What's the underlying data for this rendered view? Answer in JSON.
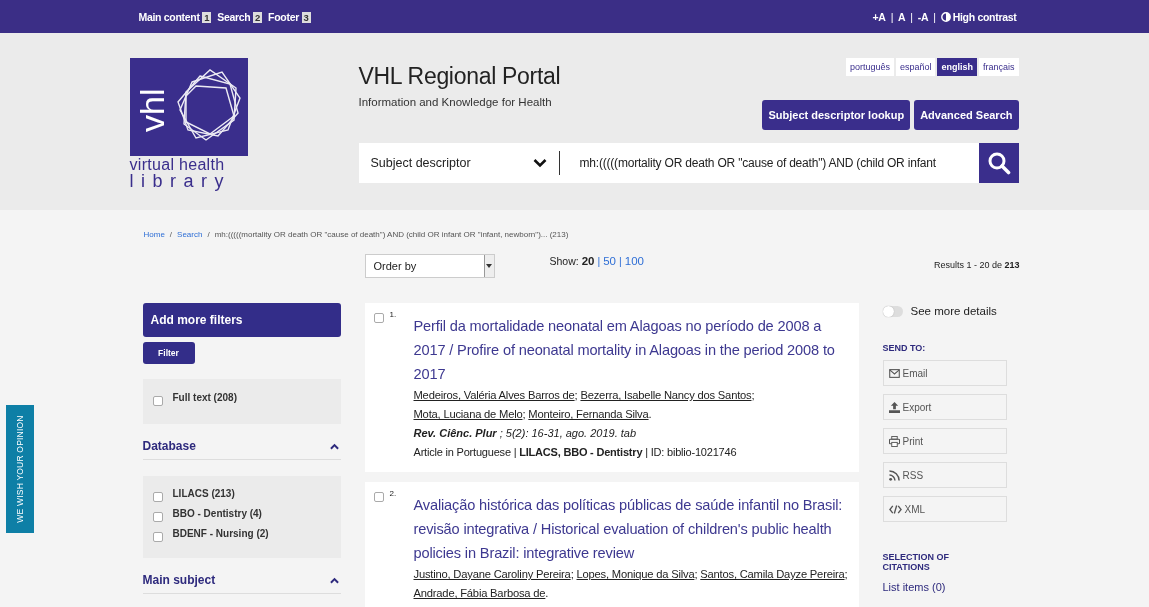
{
  "topbar": {
    "skip_links": [
      {
        "label": "Main content",
        "key": "1"
      },
      {
        "label": "Search",
        "key": "2"
      },
      {
        "label": "Footer",
        "key": "3"
      }
    ],
    "font_controls": [
      "+A",
      "A",
      "-A"
    ],
    "separator": "|",
    "contrast": "High contrast"
  },
  "logo": {
    "mark": "vhl",
    "line1": "virtual health",
    "line2": "library"
  },
  "header": {
    "title": "VHL Regional Portal",
    "subtitle": "Information and Knowledge for Health",
    "languages": [
      {
        "label": "português",
        "selected": false
      },
      {
        "label": "español",
        "selected": false
      },
      {
        "label": "english",
        "selected": true
      },
      {
        "label": "français",
        "selected": false
      }
    ],
    "buttons": [
      "Subject descriptor lookup",
      "Advanced Search"
    ],
    "search": {
      "scope": "Subject descriptor",
      "value": "mh:(((((mortality OR death OR \"cause of death\") AND (child OR infant"
    }
  },
  "breadcrumb": {
    "links": [
      "Home",
      "Search"
    ],
    "separator": "/",
    "current": "mh:(((((mortality OR death OR \"cause of death\") AND (child OR infant OR \"infant, newborn\")... (213)"
  },
  "toolbar": {
    "order_by": "Order by",
    "show_label": "Show:",
    "separator": "|",
    "page_sizes": [
      {
        "label": "20",
        "selected": true
      },
      {
        "label": "50",
        "selected": false
      },
      {
        "label": "100",
        "selected": false
      }
    ],
    "results": "Results 1 - 20 de **213**"
  },
  "feedback_tab": "WE WISH YOUR OPINION",
  "filters": {
    "add_more": "Add more filters",
    "filter_button": "Filter",
    "top_options": [
      {
        "label": "Full text (208)",
        "checked": false
      }
    ],
    "sections": [
      {
        "title": "Database",
        "expanded": true,
        "options": [
          {
            "label": "LILACS (213)",
            "checked": false
          },
          {
            "label": "BBO - Dentistry (4)",
            "checked": false
          },
          {
            "label": "BDENF - Nursing (2)",
            "checked": false
          }
        ]
      },
      {
        "title": "Main subject",
        "expanded": true
      }
    ]
  },
  "results": [
    {
      "number": "1.",
      "checked": false,
      "title": "Perfil da mortalidade neonatal em Alagoas no período de 2008 a 2017 / Profire of neonatal mortality in Alagoas in the period 2008 to 2017",
      "authors": [
        {
          "name": "Medeiros, Valéria Alves Barros de",
          "sep": ";"
        },
        {
          "name": "Bezerra, Isabelle Nancy dos Santos",
          "sep": ";"
        },
        {
          "name": "Mota, Luciana de Melo",
          "sep": ";"
        },
        {
          "name": "Monteiro, Fernanda Silva",
          "sep": "."
        }
      ],
      "journal": "Rev. Ciênc. Plur",
      "source": "; 5(2): 16-31, ago. 2019. tab",
      "meta": "Article in Portuguese | **LILACS, BBO - Dentistry** | ID: biblio-1021746"
    },
    {
      "number": "2.",
      "checked": false,
      "title": "Avaliação histórica das políticas públicas de saúde infantil no Brasil: revisão integrativa / Historical evaluation of children's public health policies in Brazil: integrative review",
      "authors": [
        {
          "name": "Justino, Dayane Caroliny Pereira",
          "sep": ";"
        },
        {
          "name": "Lopes, Monique da Silva",
          "sep": ";"
        },
        {
          "name": "Santos, Camila Dayze Pereira",
          "sep": ";"
        },
        {
          "name": "Andrade, Fábia Barbosa de",
          "sep": "."
        }
      ]
    }
  ],
  "details_toggle": {
    "label": "See more details",
    "on": false
  },
  "send_to": {
    "title": "SEND TO:",
    "actions": [
      {
        "kind": "email",
        "label": "Email"
      },
      {
        "kind": "export",
        "label": "Export"
      },
      {
        "kind": "print",
        "label": "Print"
      },
      {
        "kind": "rss",
        "label": "RSS"
      },
      {
        "kind": "xml",
        "label": "XML"
      }
    ]
  },
  "selection": {
    "title": "SELECTION OF CITATIONS",
    "link": "List items (0)"
  }
}
